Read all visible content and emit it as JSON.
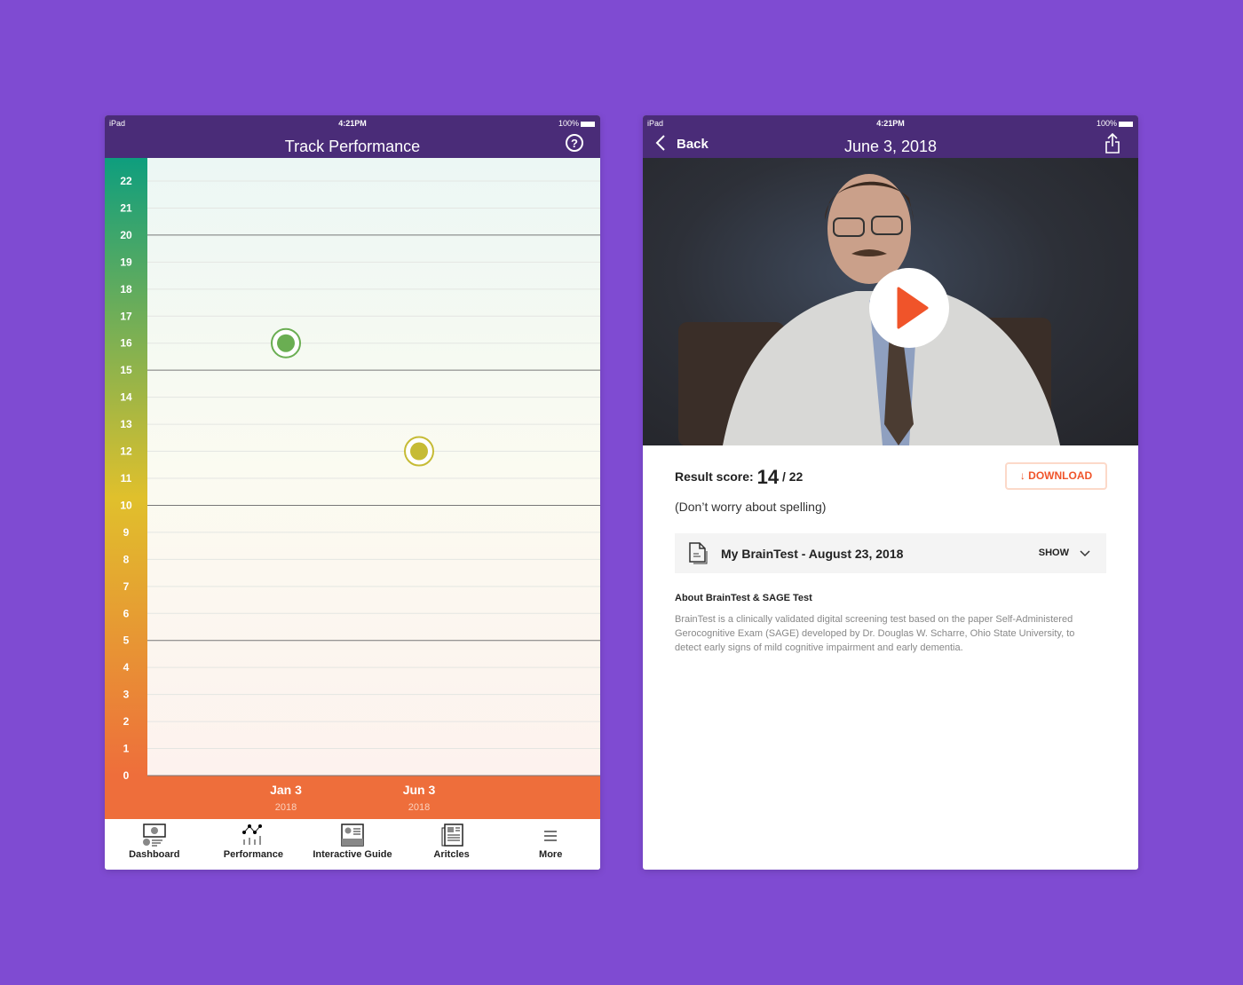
{
  "status": {
    "device": "iPad",
    "time": "4:21PM",
    "battery": "100%"
  },
  "left": {
    "title": "Track Performance",
    "tabs": [
      {
        "label": "Dashboard"
      },
      {
        "label": "Performance"
      },
      {
        "label": "Interactive Guide"
      },
      {
        "label": "Aritcles"
      },
      {
        "label": "More"
      }
    ]
  },
  "chart_data": {
    "type": "scatter",
    "title": "Track Performance",
    "ylim": [
      0,
      22
    ],
    "yticks": [
      0,
      1,
      2,
      3,
      4,
      5,
      6,
      7,
      8,
      9,
      10,
      11,
      12,
      13,
      14,
      15,
      16,
      17,
      18,
      19,
      20,
      21,
      22
    ],
    "categories": [
      "Jan 3",
      "Jun 3"
    ],
    "years": [
      "2018",
      "2018"
    ],
    "values": [
      16,
      12
    ],
    "grid": true,
    "colors": {
      "top": "#0e9e7e",
      "mid": "#e0c02c",
      "bottom": "#ee6e3b"
    }
  },
  "right": {
    "back": "Back",
    "title": "June 3, 2018",
    "score_label": "Result score:",
    "score": "14",
    "score_total": "/ 22",
    "download": "DOWNLOAD",
    "hint": "(Don’t worry about spelling)",
    "doc_title": "My BrainTest - August 23, 2018",
    "show": "SHOW",
    "about_title": "About BrainTest & SAGE Test",
    "about_text": "BrainTest is a clinically validated digital screening test based on the paper Self-Administered Gerocognitive Exam (SAGE) developed by Dr. Douglas W. Scharre, Ohio State University, to detect early signs of mild cognitive impairment and early dementia."
  }
}
